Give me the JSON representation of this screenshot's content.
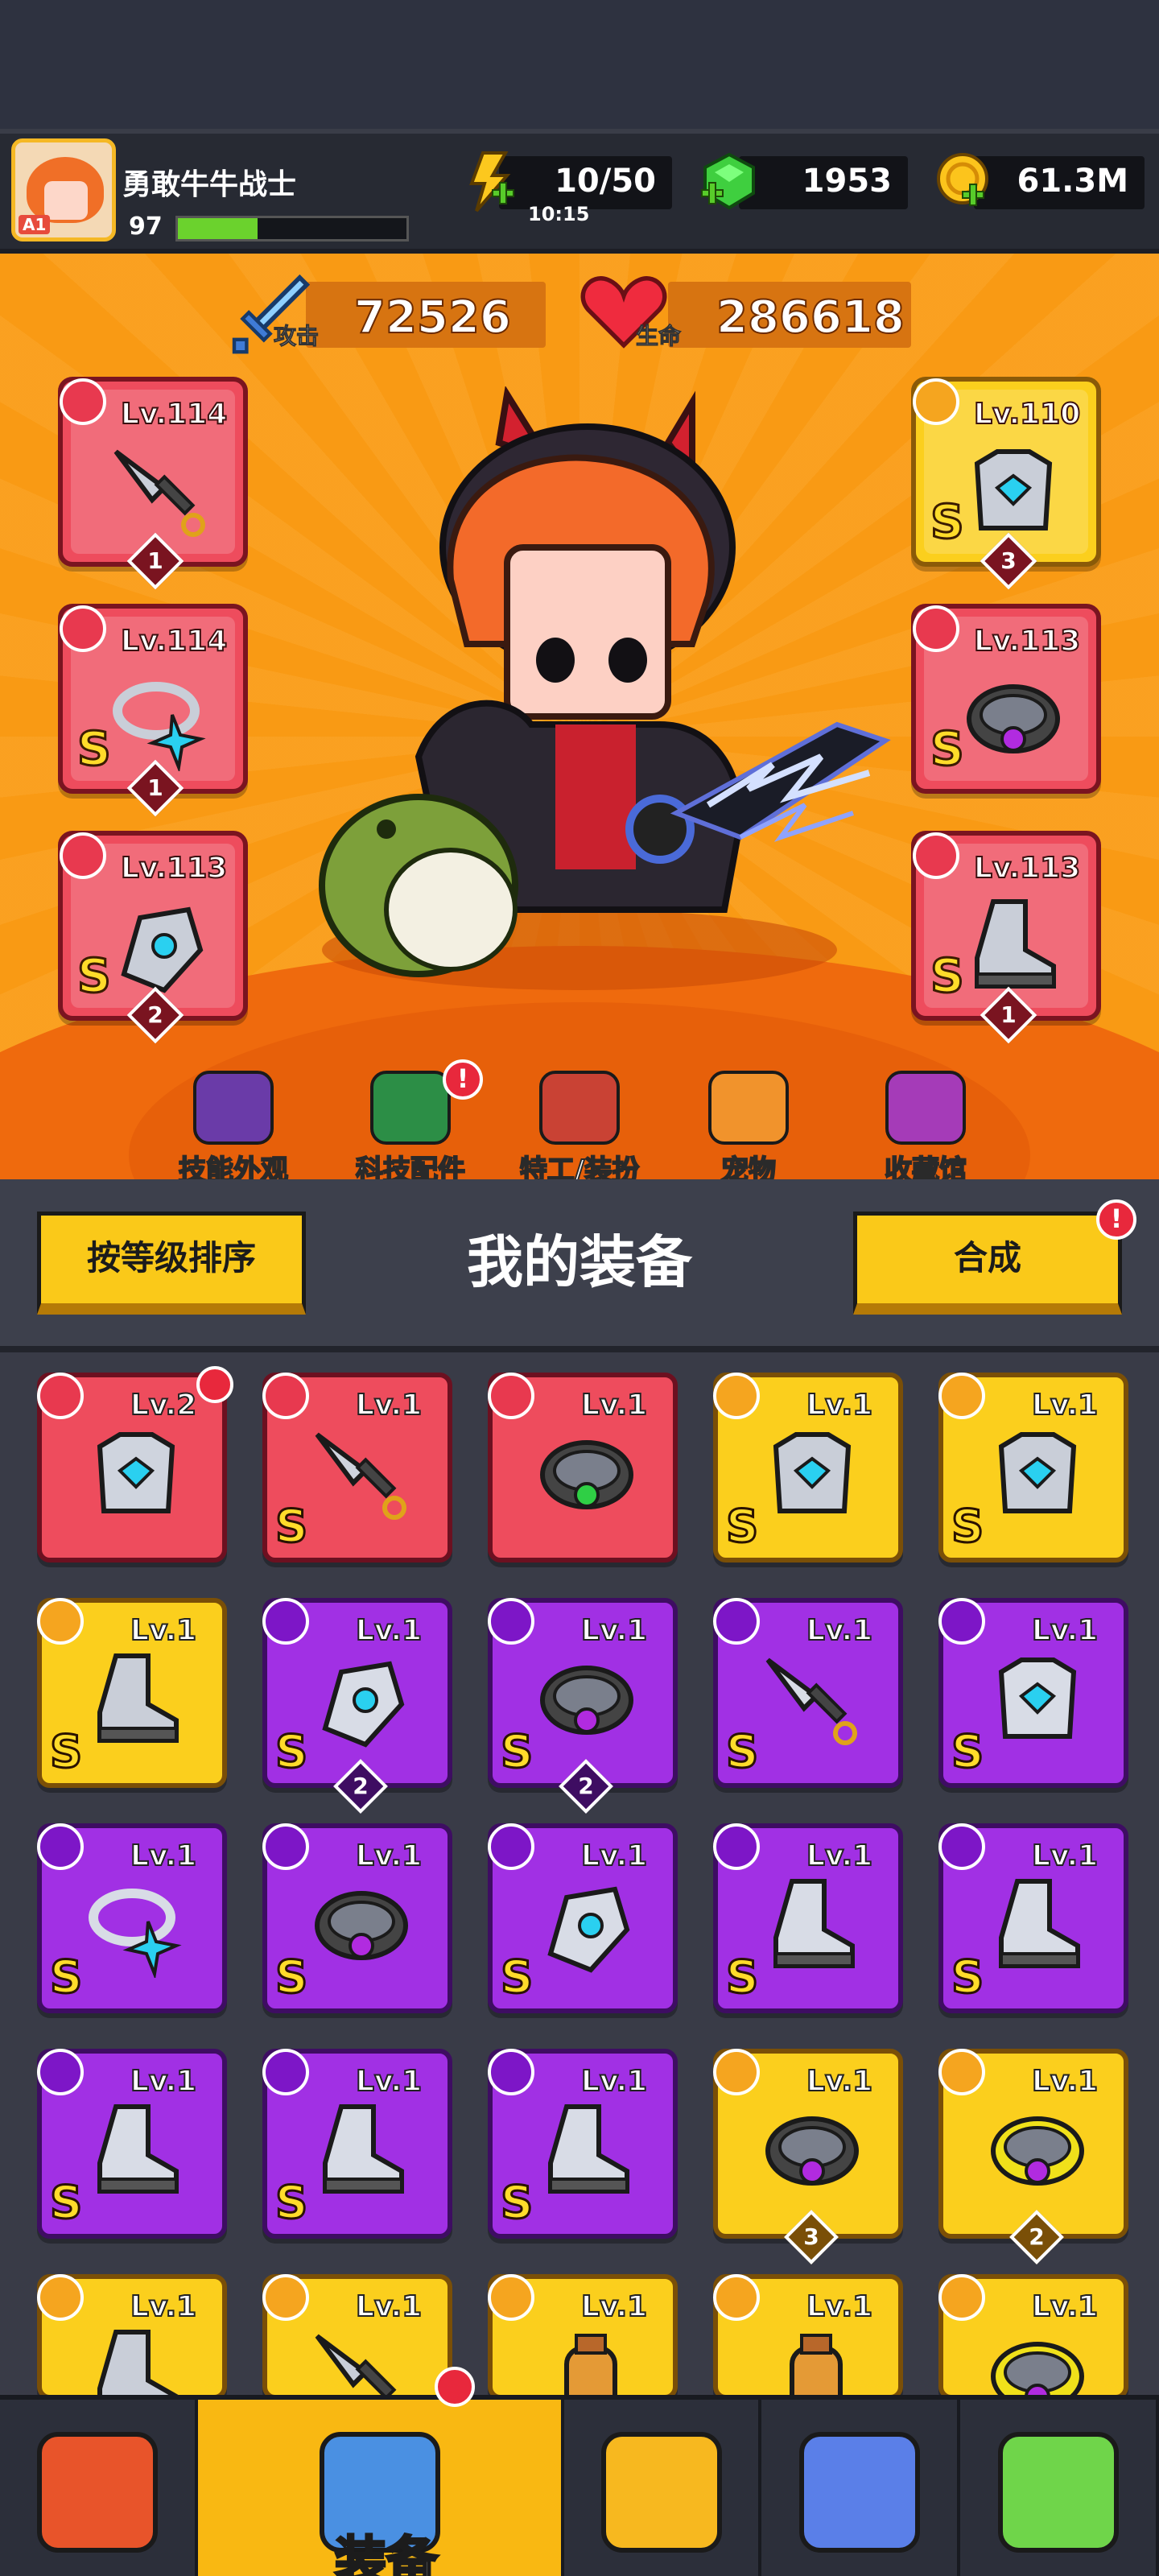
{
  "player": {
    "name": "勇敢牛牛战士",
    "level": "97",
    "badge": "A1",
    "xp_fraction": 0.35
  },
  "resources": {
    "energy": {
      "value": "10/50",
      "timer": "10:15",
      "icon": "lightning-plus-icon"
    },
    "gems": {
      "value": "1953",
      "icon": "green-gem-plus-icon"
    },
    "coins": {
      "value": "61.3M",
      "icon": "gold-coin-plus-icon"
    }
  },
  "stats": {
    "attack": {
      "label": "攻击",
      "value": "72526",
      "icon": "sword-icon"
    },
    "health": {
      "label": "生命",
      "value": "286618",
      "icon": "heart-icon"
    }
  },
  "equipped": [
    {
      "slot": "weapon",
      "level": "Lv.114",
      "rank": "",
      "stars": "1",
      "rarity": "red",
      "icon": "kunai-icon"
    },
    {
      "slot": "necklace",
      "level": "Lv.114",
      "rank": "S",
      "stars": "1",
      "rarity": "red",
      "icon": "star-necklace-icon"
    },
    {
      "slot": "gloves",
      "level": "Lv.113",
      "rank": "S",
      "stars": "2",
      "rarity": "red",
      "icon": "gauntlet-icon"
    },
    {
      "slot": "armor",
      "level": "Lv.110",
      "rank": "S",
      "stars": "3",
      "rarity": "gold",
      "icon": "mech-armor-icon"
    },
    {
      "slot": "belt",
      "level": "Lv.113",
      "rank": "S",
      "stars": "",
      "rarity": "red",
      "icon": "orb-belt-icon"
    },
    {
      "slot": "boots",
      "level": "Lv.113",
      "rank": "S",
      "stars": "1",
      "rarity": "red",
      "icon": "dark-boots-icon"
    }
  ],
  "hero_tabs": [
    {
      "label": "技能外观",
      "icon": "skill-skin-icon",
      "alert": false
    },
    {
      "label": "科技配件",
      "icon": "tech-part-icon",
      "alert": true
    },
    {
      "label": "特工/装扮",
      "icon": "agent-costume-icon",
      "alert": false
    },
    {
      "label": "宠物",
      "icon": "pet-dog-icon",
      "alert": false
    },
    {
      "label": "收藏馆",
      "icon": "collection-chest-icon",
      "alert": false
    }
  ],
  "panel": {
    "sort_label": "按等级排序",
    "title": "我的装备",
    "merge_label": "合成"
  },
  "inventory": [
    {
      "level": "Lv.2",
      "rarity": "red",
      "rank": "",
      "stars": "",
      "icon": "chest-armor-icon",
      "alert": true
    },
    {
      "level": "Lv.1",
      "rarity": "red",
      "rank": "S",
      "stars": "",
      "icon": "dark-kunai-icon",
      "alert": false
    },
    {
      "level": "Lv.1",
      "rarity": "red",
      "rank": "",
      "stars": "",
      "icon": "emerald-ring-icon",
      "alert": false
    },
    {
      "level": "Lv.1",
      "rarity": "gold",
      "rank": "S",
      "stars": "",
      "icon": "mech-armor-icon",
      "alert": false
    },
    {
      "level": "Lv.1",
      "rarity": "gold",
      "rank": "S",
      "stars": "",
      "icon": "dark-armor-icon",
      "alert": false
    },
    {
      "level": "Lv.1",
      "rarity": "gold",
      "rank": "S",
      "stars": "",
      "icon": "mech-boots-icon",
      "alert": false
    },
    {
      "level": "Lv.1",
      "rarity": "purple",
      "rank": "S",
      "stars": "2",
      "icon": "orb-gauntlet-icon",
      "alert": false
    },
    {
      "level": "Lv.1",
      "rarity": "purple",
      "rank": "S",
      "stars": "2",
      "icon": "orb-belt-icon",
      "alert": false
    },
    {
      "level": "Lv.1",
      "rarity": "purple",
      "rank": "S",
      "stars": "",
      "icon": "dark-kunai-icon",
      "alert": false
    },
    {
      "level": "Lv.1",
      "rarity": "purple",
      "rank": "S",
      "stars": "",
      "icon": "mech-armor-icon",
      "alert": false
    },
    {
      "level": "Lv.1",
      "rarity": "purple",
      "rank": "S",
      "stars": "",
      "icon": "star-necklace-icon",
      "alert": false
    },
    {
      "level": "Lv.1",
      "rarity": "purple",
      "rank": "S",
      "stars": "",
      "icon": "hex-belt-icon",
      "alert": false
    },
    {
      "level": "Lv.1",
      "rarity": "purple",
      "rank": "S",
      "stars": "",
      "icon": "blade-gauntlet-icon",
      "alert": false
    },
    {
      "level": "Lv.1",
      "rarity": "purple",
      "rank": "S",
      "stars": "",
      "icon": "mech-boots-icon",
      "alert": false
    },
    {
      "level": "Lv.1",
      "rarity": "purple",
      "rank": "S",
      "stars": "",
      "icon": "dark-boots-icon",
      "alert": false
    },
    {
      "level": "Lv.1",
      "rarity": "purple",
      "rank": "S",
      "stars": "",
      "icon": "silver-boots-icon",
      "alert": false
    },
    {
      "level": "Lv.1",
      "rarity": "purple",
      "rank": "S",
      "stars": "",
      "icon": "silver-boots-icon",
      "alert": false
    },
    {
      "level": "Lv.1",
      "rarity": "purple",
      "rank": "S",
      "stars": "",
      "icon": "silver-boots-icon",
      "alert": false
    },
    {
      "level": "Lv.1",
      "rarity": "gold",
      "rank": "",
      "stars": "3",
      "icon": "star-belt-icon",
      "alert": false
    },
    {
      "level": "Lv.1",
      "rarity": "gold",
      "rank": "",
      "stars": "2",
      "icon": "spiked-collar-icon",
      "alert": false
    },
    {
      "level": "Lv.1",
      "rarity": "gold",
      "rank": "",
      "stars": "",
      "icon": "boots-icon",
      "alert": false
    },
    {
      "level": "Lv.1",
      "rarity": "gold",
      "rank": "",
      "stars": "",
      "icon": "kunai-icon",
      "alert": false
    },
    {
      "level": "Lv.1",
      "rarity": "gold",
      "rank": "",
      "stars": "",
      "icon": "potion-icon",
      "alert": false
    },
    {
      "level": "Lv.1",
      "rarity": "gold",
      "rank": "",
      "stars": "",
      "icon": "potion-icon",
      "alert": false
    },
    {
      "level": "Lv.1",
      "rarity": "gold",
      "rank": "",
      "stars": "",
      "icon": "collar-icon",
      "alert": false
    }
  ],
  "bottom_nav": [
    {
      "id": "shop",
      "label": "",
      "icon": "shop-stall-icon",
      "active": false
    },
    {
      "id": "equipment",
      "label": "装备",
      "icon": "equipment-bag-icon",
      "active": true
    },
    {
      "id": "battle",
      "label": "",
      "icon": "crossed-swords-star-icon",
      "active": false
    },
    {
      "id": "talent",
      "label": "",
      "icon": "star-orb-icon",
      "active": false
    },
    {
      "id": "evolve",
      "label": "",
      "icon": "dna-capsule-icon",
      "active": false
    }
  ],
  "colors": {
    "hero_bg": "#f99a14",
    "panel_bg": "#393b47",
    "red": "#ee4c5d",
    "gold": "#fbcf1d",
    "purple": "#a130e4",
    "button": "#fac919"
  }
}
